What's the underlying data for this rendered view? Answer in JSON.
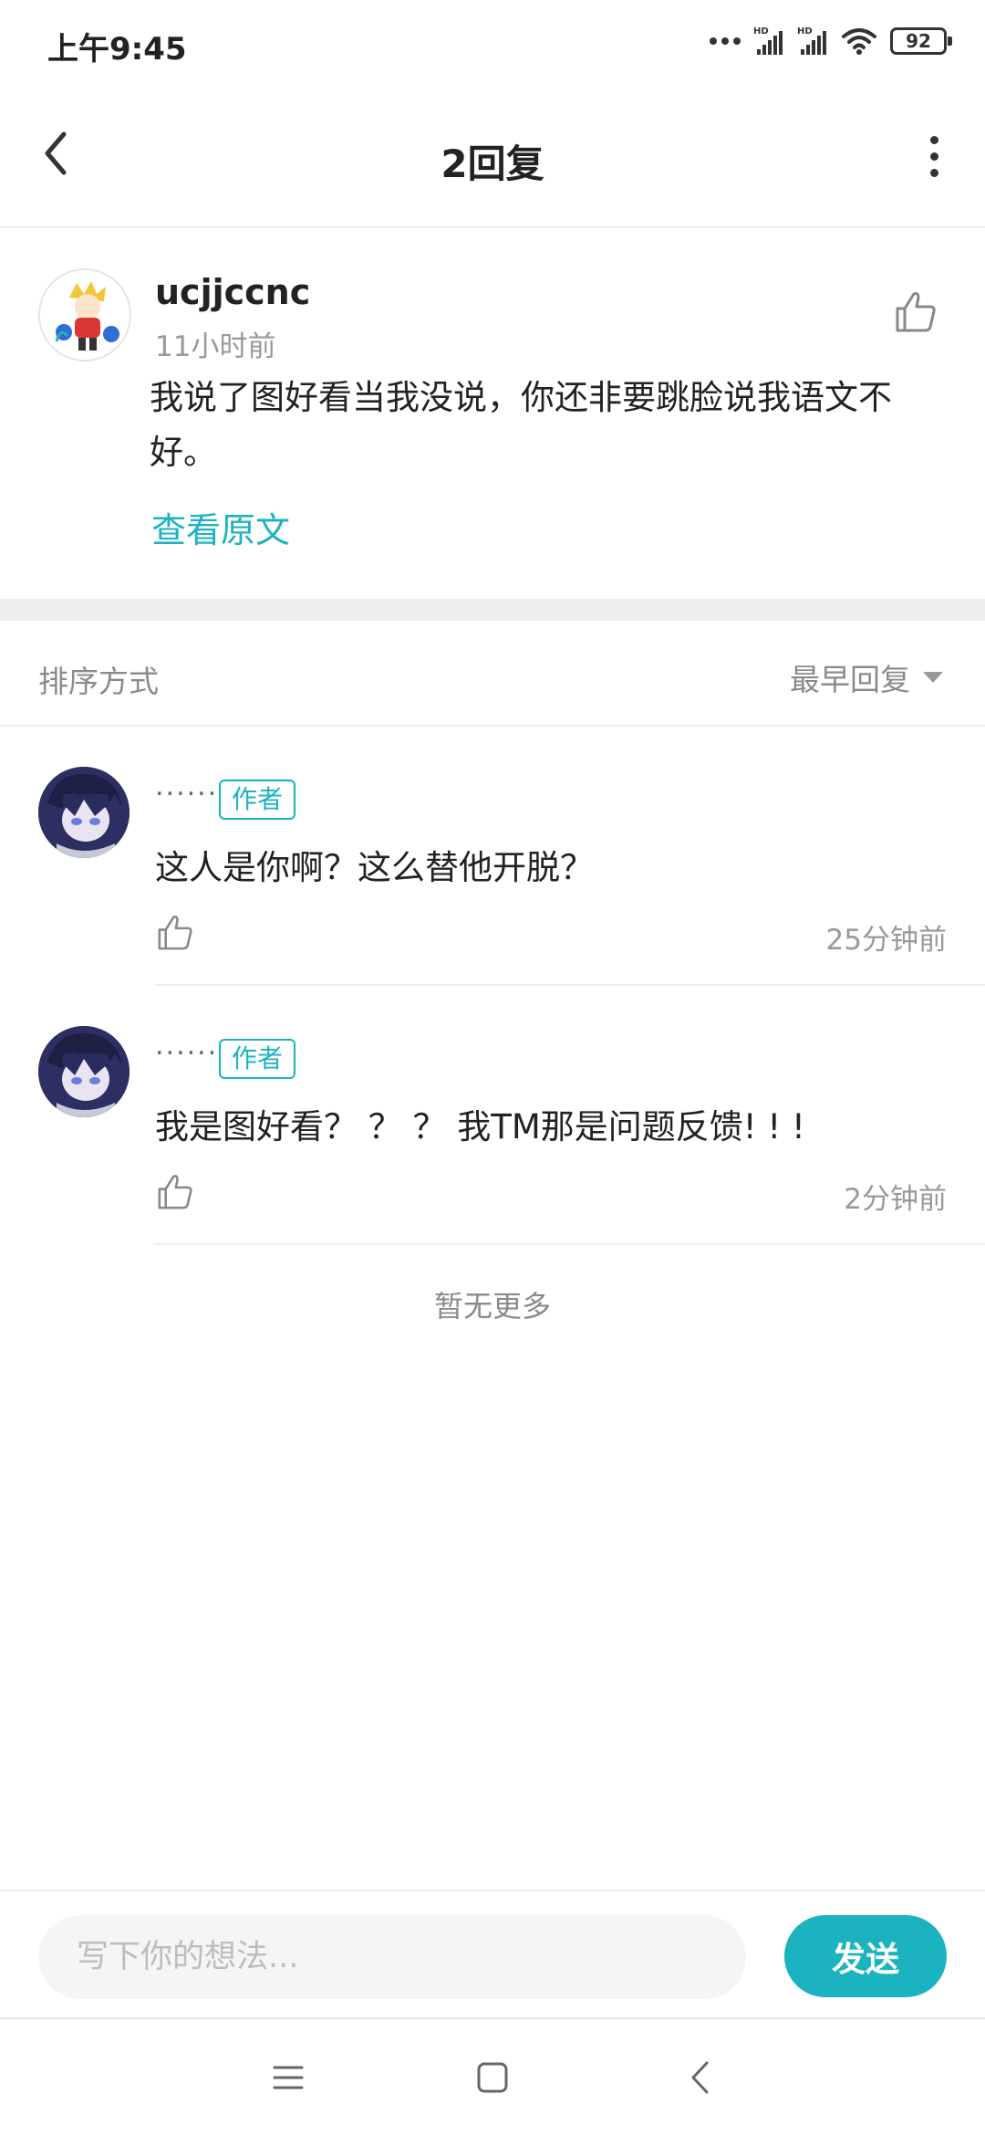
{
  "status_bar": {
    "time": "上午9:45",
    "battery": "92",
    "icons": [
      "dots-icon",
      "signal-hd-icon",
      "signal-hd-icon",
      "wifi-icon",
      "battery-icon"
    ]
  },
  "header": {
    "title": "2回复",
    "back_icon": "chevron-left-icon",
    "more_icon": "more-vertical-icon"
  },
  "main_comment": {
    "username": "ucjjccnc",
    "time": "11小时前",
    "content": "我说了图好看当我没说，你还非要跳脸说我语文不好。",
    "view_original": "查看原文",
    "like_icon": "thumbs-up-icon"
  },
  "sort": {
    "label": "排序方式",
    "selected": "最早回复"
  },
  "replies": [
    {
      "username": "......",
      "badge": "作者",
      "content": "这人是你啊？这么替他开脱？",
      "time": "25分钟前"
    },
    {
      "username": "......",
      "badge": "作者",
      "content": "我是图好看？ ？ ？ 我TM那是问题反馈! ! !",
      "time": "2分钟前"
    }
  ],
  "no_more": "暂无更多",
  "input": {
    "placeholder": "写下你的想法...",
    "value": "",
    "send_label": "发送"
  },
  "colors": {
    "accent": "#1bb3bf",
    "text": "#222222",
    "muted": "#999999",
    "divider": "#eeeeee"
  }
}
